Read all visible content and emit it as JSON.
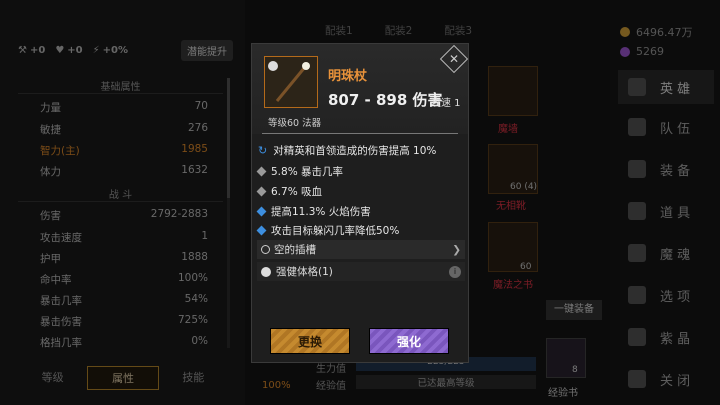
{
  "left_panel": {
    "topbar": {
      "a": "+0",
      "b": "+0",
      "c": "+0%",
      "boost": "潜能提升"
    },
    "basic_title": "基础属性",
    "basic": [
      {
        "label": "力量",
        "value": "70"
      },
      {
        "label": "敏捷",
        "value": "276"
      },
      {
        "label": "智力(主)",
        "value": "1985"
      },
      {
        "label": "体力",
        "value": "1632"
      }
    ],
    "combat_title": "战 斗",
    "combat": [
      {
        "label": "伤害",
        "value": "2792-2883"
      },
      {
        "label": "攻击速度",
        "value": "1"
      },
      {
        "label": "护甲",
        "value": "1888"
      },
      {
        "label": "命中率",
        "value": "100%"
      },
      {
        "label": "暴击几率",
        "value": "54%"
      },
      {
        "label": "暴击伤害",
        "value": "725%"
      },
      {
        "label": "格挡几率",
        "value": "0%"
      }
    ],
    "tabs": [
      "等级",
      "属性",
      "技能"
    ]
  },
  "mid": {
    "slot_tabs": [
      "配装1",
      "配装2",
      "配装3"
    ],
    "cards": [
      {
        "label": "魔墙",
        "level": ""
      },
      {
        "label": "无相靴",
        "level": "60 (4)"
      },
      {
        "label": "魔法之书",
        "level": "60"
      }
    ],
    "one_key": "一键装备",
    "pct": "100%",
    "hp_text": "225/225",
    "xp_label": "经验值",
    "xp_text": "已达最高等级",
    "power_label": "生力值",
    "book_label": "经验书",
    "book_count": "8"
  },
  "right_panel": {
    "gold": "6496.47万",
    "gems": "5269",
    "menu": [
      "英 雄",
      "队 伍",
      "装 备",
      "道 具",
      "魔 魂",
      "选 项",
      "紫 晶",
      "关 闭"
    ]
  },
  "popup": {
    "name": "明珠杖",
    "damage": "807 - 898 伤害",
    "speed": "攻速 1",
    "level": "等级60 法器",
    "props": [
      "对精英和首领造成的伤害提高 10%",
      "5.8% 暴击几率",
      "6.7% 吸血",
      "提高11.3% 火焰伤害",
      "攻击目标躲闪几率降低50%"
    ],
    "socket": "空的插槽",
    "gem": "强健体格(1)",
    "swap": "更换",
    "upgrade": "强化",
    "colors": {
      "name": "#e8923a",
      "legend_prop": "#3d8fe0",
      "plain_prop": "#9a9a9a"
    }
  }
}
